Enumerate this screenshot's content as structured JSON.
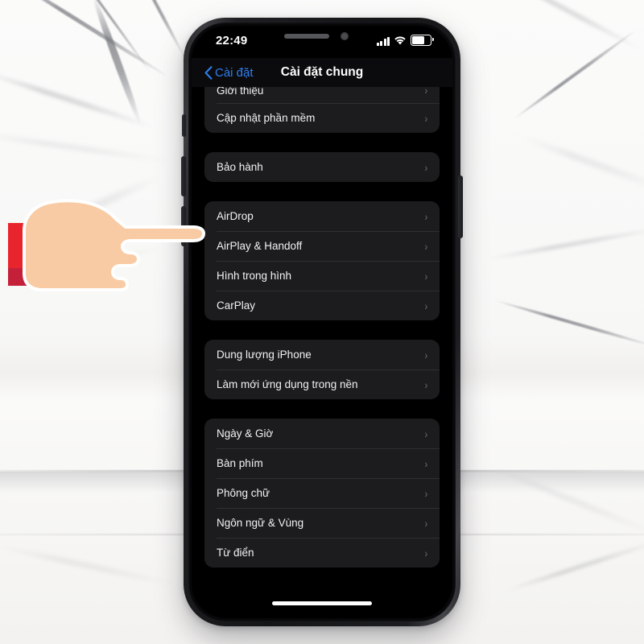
{
  "scene": {
    "background_name": "marble-surface",
    "background_color": "#f7f7f6"
  },
  "phone": {
    "frame_color": "#1e1f22",
    "screen_background": "#000000",
    "buttons": [
      {
        "name": "mute-switch"
      },
      {
        "name": "volume-up-button"
      },
      {
        "name": "volume-down-button"
      },
      {
        "name": "power-button"
      }
    ],
    "notch": {
      "speaker_name": "earpiece-speaker",
      "camera_name": "front-camera"
    }
  },
  "status_bar": {
    "time": "22:49",
    "cellular_icon": "signal-bars-icon",
    "wifi_icon": "wifi-icon",
    "battery_icon": "battery-icon",
    "battery_level_percent": 62
  },
  "nav_bar": {
    "back_label": "Cài đặt",
    "back_icon": "chevron-left-icon",
    "title": "Cài đặt chung",
    "accent_color": "#2f7ff0"
  },
  "list": {
    "chevron_glyph": "›",
    "card_color": "#1c1c1e",
    "groups": [
      {
        "name": "about-group",
        "clipped_top": true,
        "rows": [
          {
            "label": "Giới thiệu",
            "cut": true
          },
          {
            "label": "Cập nhật phần mềm",
            "cut": false
          }
        ]
      },
      {
        "name": "warranty-group",
        "clipped_top": false,
        "rows": [
          {
            "label": "Bảo hành",
            "cut": false
          }
        ]
      },
      {
        "name": "connectivity-group",
        "clipped_top": false,
        "rows": [
          {
            "label": "AirDrop",
            "cut": false
          },
          {
            "label": "AirPlay & Handoff",
            "cut": false
          },
          {
            "label": "Hình trong hình",
            "cut": false
          },
          {
            "label": "CarPlay",
            "cut": false
          }
        ]
      },
      {
        "name": "storage-group",
        "clipped_top": false,
        "rows": [
          {
            "label": "Dung lượng iPhone",
            "cut": false
          },
          {
            "label": "Làm mới ứng dụng trong nền",
            "cut": false
          }
        ]
      },
      {
        "name": "localization-group",
        "clipped_top": false,
        "rows": [
          {
            "label": "Ngày & Giờ",
            "cut": false
          },
          {
            "label": "Bàn phím",
            "cut": false
          },
          {
            "label": "Phông chữ",
            "cut": false
          },
          {
            "label": "Ngôn ngữ & Vùng",
            "cut": false
          },
          {
            "label": "Từ điển",
            "cut": false
          }
        ]
      }
    ]
  },
  "home_indicator": {
    "name": "home-indicator"
  },
  "pointer": {
    "name": "pointing-hand-cursor",
    "skin_color": "#f8cba4",
    "outline_color": "#ffffff",
    "sleeve_color": "#e8252c",
    "sleeve_shadow_color": "#c4203a",
    "points_at": "AirDrop"
  }
}
